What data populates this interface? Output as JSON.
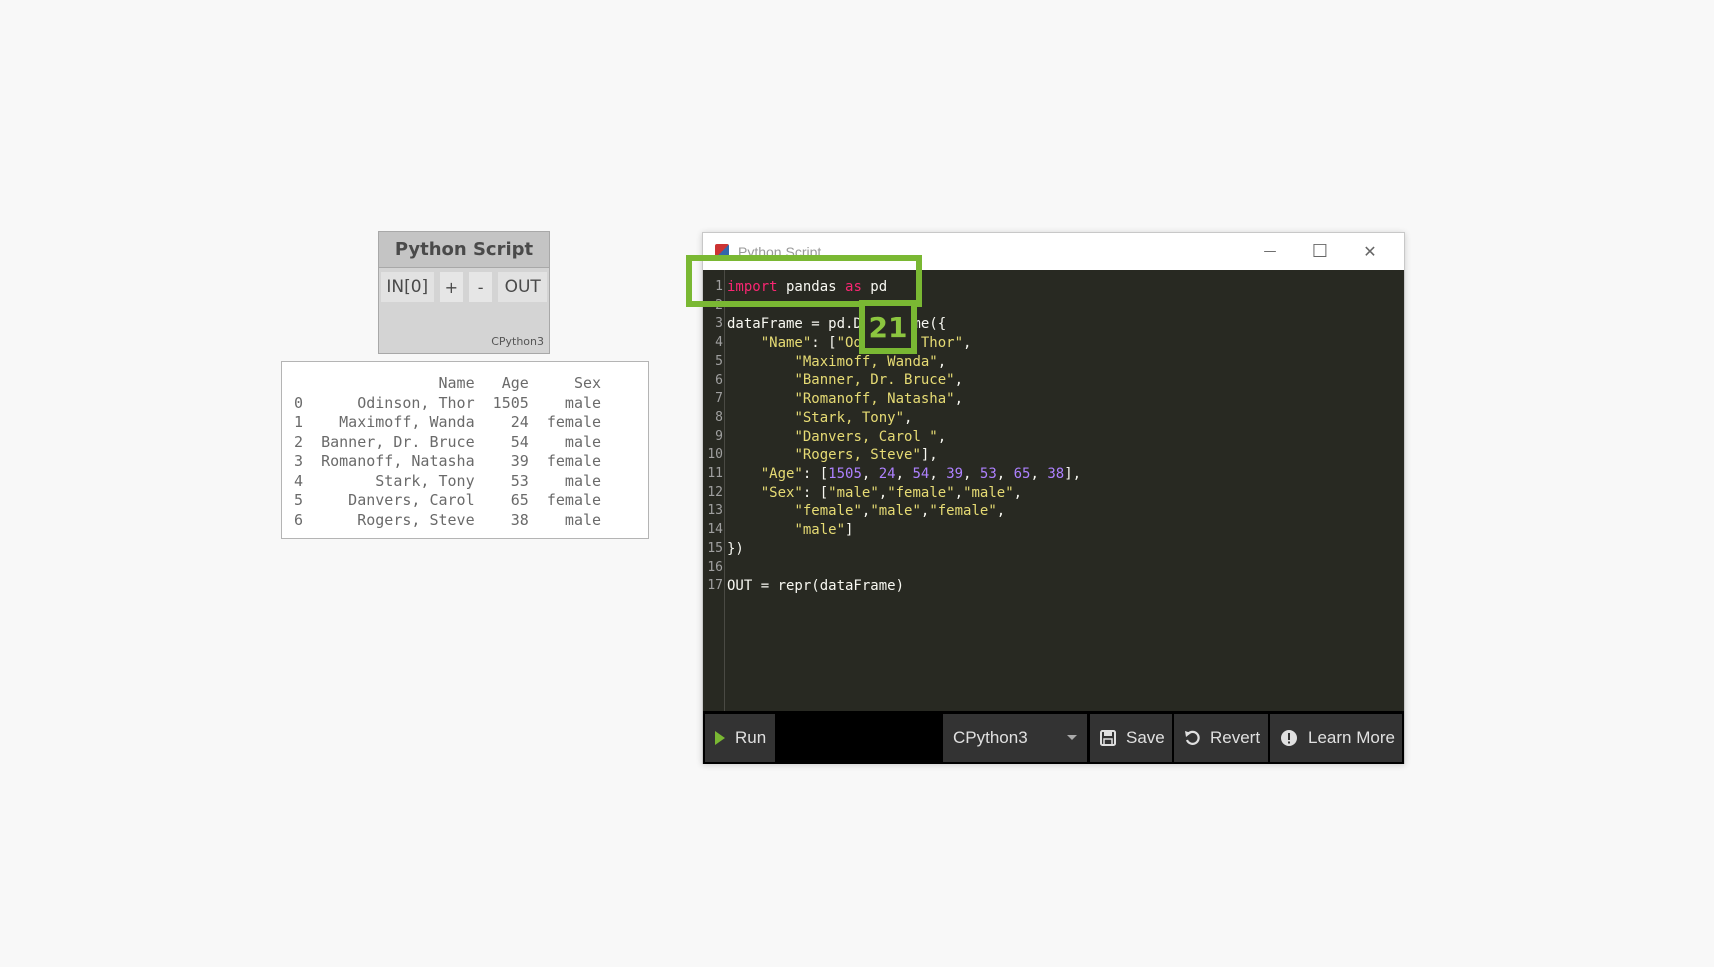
{
  "node": {
    "title": "Python Script",
    "in_port": "IN[0]",
    "add_label": "+",
    "remove_label": "-",
    "out_port": "OUT",
    "engine": "CPython3"
  },
  "preview": {
    "lines": [
      "                Name   Age     Sex",
      "0      Odinson, Thor  1505    male",
      "1    Maximoff, Wanda    24  female",
      "2  Banner, Dr. Bruce    54    male",
      "3  Romanoff, Natasha    39  female",
      "4        Stark, Tony    53    male",
      "5     Danvers, Carol    65  female",
      "6      Rogers, Steve    38    male"
    ]
  },
  "window": {
    "title": "Python Script",
    "minimize_glyph": "—",
    "maximize_glyph": "☐",
    "close_glyph": "✕",
    "line_numbers": [
      "1",
      "2",
      "3",
      "4",
      "5",
      "6",
      "7",
      "8",
      "9",
      "10",
      "11",
      "12",
      "13",
      "14",
      "15",
      "16",
      "17"
    ],
    "code_lines": [
      [
        {
          "t": "import",
          "c": "kw"
        },
        {
          "t": " pandas "
        },
        {
          "t": "as",
          "c": "kw"
        },
        {
          "t": " pd"
        }
      ],
      [
        {
          "t": ""
        }
      ],
      [
        {
          "t": "dataFrame = pd.DataFrame({"
        }
      ],
      [
        {
          "t": "    "
        },
        {
          "t": "\"Name\"",
          "c": "str"
        },
        {
          "t": ": ["
        },
        {
          "t": "\"Odinson, Thor\"",
          "c": "str"
        },
        {
          "t": ","
        }
      ],
      [
        {
          "t": "        "
        },
        {
          "t": "\"Maximoff, Wanda\"",
          "c": "str"
        },
        {
          "t": ","
        }
      ],
      [
        {
          "t": "        "
        },
        {
          "t": "\"Banner, Dr. Bruce\"",
          "c": "str"
        },
        {
          "t": ","
        }
      ],
      [
        {
          "t": "        "
        },
        {
          "t": "\"Romanoff, Natasha\"",
          "c": "str"
        },
        {
          "t": ","
        }
      ],
      [
        {
          "t": "        "
        },
        {
          "t": "\"Stark, Tony\"",
          "c": "str"
        },
        {
          "t": ","
        }
      ],
      [
        {
          "t": "        "
        },
        {
          "t": "\"Danvers, Carol \"",
          "c": "str"
        },
        {
          "t": ","
        }
      ],
      [
        {
          "t": "        "
        },
        {
          "t": "\"Rogers, Steve\"",
          "c": "str"
        },
        {
          "t": "],"
        }
      ],
      [
        {
          "t": "    "
        },
        {
          "t": "\"Age\"",
          "c": "str"
        },
        {
          "t": ": ["
        },
        {
          "t": "1505",
          "c": "num"
        },
        {
          "t": ", "
        },
        {
          "t": "24",
          "c": "num"
        },
        {
          "t": ", "
        },
        {
          "t": "54",
          "c": "num"
        },
        {
          "t": ", "
        },
        {
          "t": "39",
          "c": "num"
        },
        {
          "t": ", "
        },
        {
          "t": "53",
          "c": "num"
        },
        {
          "t": ", "
        },
        {
          "t": "65",
          "c": "num"
        },
        {
          "t": ", "
        },
        {
          "t": "38",
          "c": "num"
        },
        {
          "t": "],"
        }
      ],
      [
        {
          "t": "    "
        },
        {
          "t": "\"Sex\"",
          "c": "str"
        },
        {
          "t": ": ["
        },
        {
          "t": "\"male\"",
          "c": "str"
        },
        {
          "t": ","
        },
        {
          "t": "\"female\"",
          "c": "str"
        },
        {
          "t": ","
        },
        {
          "t": "\"male\"",
          "c": "str"
        },
        {
          "t": ","
        }
      ],
      [
        {
          "t": "        "
        },
        {
          "t": "\"female\"",
          "c": "str"
        },
        {
          "t": ","
        },
        {
          "t": "\"male\"",
          "c": "str"
        },
        {
          "t": ","
        },
        {
          "t": "\"female\"",
          "c": "str"
        },
        {
          "t": ","
        }
      ],
      [
        {
          "t": "        "
        },
        {
          "t": "\"male\"",
          "c": "str"
        },
        {
          "t": "]"
        }
      ],
      [
        {
          "t": "})"
        }
      ],
      [
        {
          "t": ""
        }
      ],
      [
        {
          "t": "OUT = repr(dataFrame)"
        }
      ]
    ]
  },
  "toolbar": {
    "run_label": "Run",
    "engine_selected": "CPython3",
    "save_label": "Save",
    "revert_label": "Revert",
    "learn_more_label": "Learn More"
  },
  "annotation": {
    "badge_number": "21",
    "color": "#7ab833"
  },
  "colors": {
    "editor_bg": "#282922",
    "keyword": "#f92672",
    "string": "#e6db74",
    "number": "#ae81ff"
  }
}
